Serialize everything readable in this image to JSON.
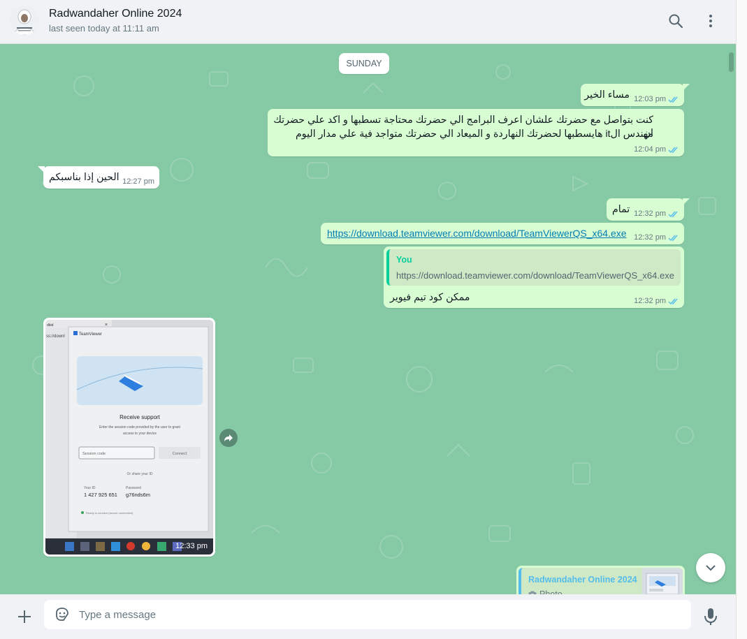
{
  "header": {
    "contact_name": "Radwandaher Online 2024",
    "status": "last seen today at 11:11 am"
  },
  "chat": {
    "day_label": "SUNDAY",
    "messages": [
      {
        "text": "مساء الخير",
        "time": "12:03 pm"
      },
      {
        "line1": "كنت بتواصل مع حضرتك علشان اعرف البرامج الي حضرتك محتاجة تسطبها و اكد علي حضرتك ان",
        "line2": "مهندس الit  هايسطبها لحضرتك النهاردة و الميعاد الي حضرتك متواجد فية علي مدار اليوم",
        "time": "12:04 pm"
      },
      {
        "text": "الحين إذا بناسبكم",
        "time": "12:27 pm"
      },
      {
        "text": "تمام",
        "time": "12:32 pm"
      },
      {
        "text": "https://download.teamviewer.com/download/TeamViewerQS_x64.exe",
        "time": "12:32 pm"
      },
      {
        "quote_author": "You",
        "quote_text": "https://download.teamviewer.com/download/TeamViewerQS_x64.exe",
        "text": "ممكن كود تيم فيوير",
        "time": "12:32 pm"
      }
    ],
    "image_message": {
      "time": "12:33 pm",
      "screen": {
        "window_title": "TeamViewer",
        "heading": "Receive support",
        "desc1": "Enter the session code provided by the user to grant",
        "desc2": "access to your device",
        "session_placeholder": "Session code",
        "connect_label": "Connect",
        "id_label": "Your ID",
        "id_value": "1 427 925 651",
        "pw_label": "Password",
        "pw_value": "g76nds6m",
        "share_label": "Or share your ID",
        "ready_label": "Ready to connect (secure connection)",
        "tab_label": "dbid",
        "url_snippet": "ss://downl"
      }
    },
    "reply_preview": {
      "author": "Radwandaher Online 2024",
      "type": "Photo"
    }
  },
  "footer": {
    "placeholder": "Type a message"
  },
  "colors": {
    "chat_bg": "#85c9a5",
    "outgoing": "#d9fdd3",
    "incoming": "#ffffff",
    "read_ticks": "#53bdeb",
    "quote_accent": "#06cf9c"
  }
}
